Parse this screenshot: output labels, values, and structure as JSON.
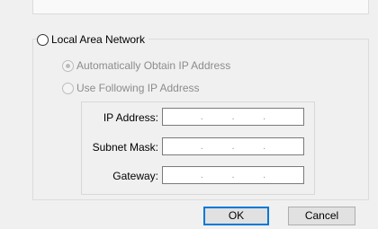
{
  "network": {
    "legend": "Local Area Network",
    "auto_option": "Automatically Obtain IP Address",
    "manual_option": "Use Following IP Address",
    "fields": [
      {
        "label": "IP Address:",
        "value": ". . ."
      },
      {
        "label": "Subnet Mask:",
        "value": ". . ."
      },
      {
        "label": "Gateway:",
        "value": ". . ."
      }
    ]
  },
  "buttons": {
    "ok": "OK",
    "cancel": "Cancel"
  }
}
